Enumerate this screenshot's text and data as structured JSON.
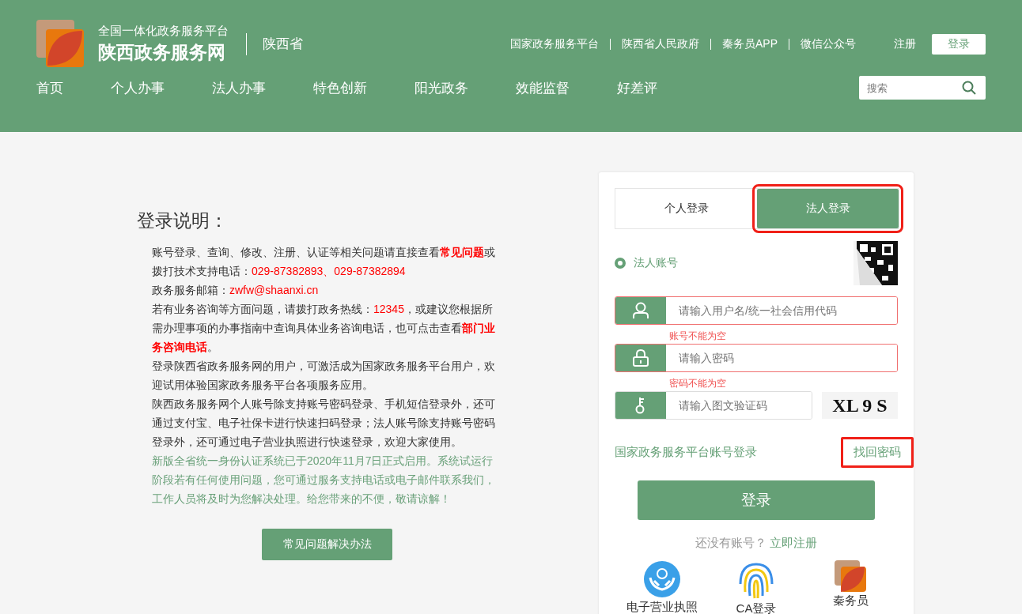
{
  "header": {
    "logo_subtitle": "全国一体化政务服务平台",
    "logo_title": "陕西政务服务网",
    "region": "陕西省",
    "top_links": [
      "国家政务服务平台",
      "陕西省人民政府",
      "秦务员APP",
      "微信公众号"
    ],
    "register": "注册",
    "login": "登录",
    "nav": [
      {
        "label": "首页"
      },
      {
        "label": "个人办事"
      },
      {
        "label": "法人办事"
      },
      {
        "label": "特色创新"
      },
      {
        "label": "阳光政务"
      },
      {
        "label": "效能监督"
      },
      {
        "label": "好差评"
      }
    ],
    "search": {
      "placeholder": "搜索"
    }
  },
  "notes": {
    "title": "登录说明：",
    "paragraphs": [
      {
        "kind": "normal",
        "parts": [
          {
            "text": "账号登录、查询、修改、注册、认证等相关问题请直接查看",
            "kind": "plain"
          },
          {
            "text": "常见问题",
            "kind": "strong"
          },
          {
            "text": "或拨打技术支持电话：",
            "kind": "plain"
          },
          {
            "text": "029-87382893、029-87382894",
            "kind": "highlight"
          }
        ]
      },
      {
        "kind": "normal",
        "parts": [
          {
            "text": "政务服务邮箱：",
            "kind": "plain"
          },
          {
            "text": "zwfw@shaanxi.cn",
            "kind": "highlight"
          }
        ]
      },
      {
        "kind": "normal",
        "parts": [
          {
            "text": "若有业务咨询等方面问题，请拨打政务热线：",
            "kind": "plain"
          },
          {
            "text": "12345",
            "kind": "highlight"
          },
          {
            "text": "，或建议您根据所需办理事项的办事指南中查询具体业务咨询电话，也可点击查看",
            "kind": "plain"
          },
          {
            "text": "部门业务咨询电话",
            "kind": "strong"
          },
          {
            "text": "。",
            "kind": "plain"
          }
        ]
      },
      {
        "kind": "normal",
        "parts": [
          {
            "text": "登录陕西省政务服务网的用户，可激活成为国家政务服务平台用户，欢迎试用体验国家政务服务平台各项服务应用。",
            "kind": "plain"
          }
        ]
      },
      {
        "kind": "normal",
        "parts": [
          {
            "text": "陕西政务服务网个人账号除支持账号密码登录、手机短信登录外，还可通过支付宝、电子社保卡进行快速扫码登录；法人账号除支持账号密码登录外，还可通过电子营业执照进行快速登录，欢迎大家使用。",
            "kind": "plain"
          }
        ]
      },
      {
        "kind": "notice",
        "parts": [
          {
            "text": "新版全省统一身份认证系统已于2020年11月7日正式启用。系统试运行阶段若有任何使用问题，您可通过服务支持电话或电子邮件联系我们，工作人员将及时为您解决处理。给您带来的不便，敬请谅解！",
            "kind": "plain"
          }
        ]
      }
    ],
    "faq_button": "常见问题解决办法"
  },
  "login": {
    "tabs": [
      {
        "label": "个人登录",
        "selected": false,
        "highlighted": false
      },
      {
        "label": "法人登录",
        "selected": true,
        "highlighted": true
      }
    ],
    "account_type": {
      "label": "法人账号",
      "selected": true
    },
    "fields": [
      {
        "kind": "user",
        "placeholder": "请输入用户名/统一社会信用代码",
        "error": "账号不能为空"
      },
      {
        "kind": "lock",
        "placeholder": "请输入密码",
        "error": "密码不能为空"
      },
      {
        "kind": "key",
        "placeholder": "请输入图文验证码"
      }
    ],
    "captcha": "XL 9 S",
    "national_login": "国家政务服务平台账号登录",
    "forgot": {
      "label": "找回密码",
      "highlighted": true
    },
    "submit": "登录",
    "no_account": "还没有账号？",
    "register": "立即注册",
    "methods": [
      {
        "kind": "license",
        "label": "电子营业执照"
      },
      {
        "kind": "ca",
        "label": "CA登录"
      },
      {
        "kind": "app",
        "label": "秦务员"
      }
    ]
  }
}
